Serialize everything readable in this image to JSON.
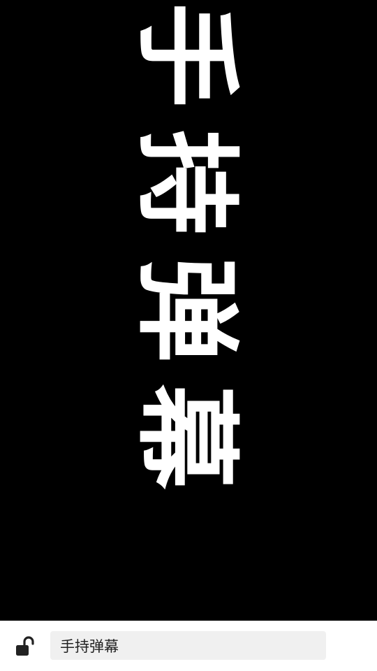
{
  "display": {
    "text": "手持弹幕",
    "text_color": "#ffffff",
    "background_color": "#000000"
  },
  "bottom_bar": {
    "lock_icon": "unlocked-padlock-icon",
    "input_value": "手持弹幕",
    "background_color": "#ffffff",
    "input_background": "#f0f0f0"
  }
}
